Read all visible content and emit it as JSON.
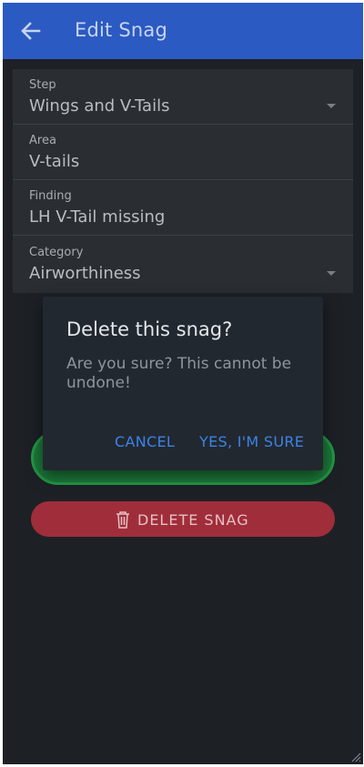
{
  "appbar": {
    "title": "Edit Snag",
    "back_icon": "arrow-left-icon"
  },
  "form": {
    "fields": [
      {
        "label": "Step",
        "value": "Wings and V-Tails",
        "has_dropdown": true
      },
      {
        "label": "Area",
        "value": "V-tails",
        "has_dropdown": false
      },
      {
        "label": "Finding",
        "value": "LH V-Tail missing",
        "has_dropdown": false
      },
      {
        "label": "Category",
        "value": "Airworthiness",
        "has_dropdown": true
      }
    ]
  },
  "delete_button": {
    "label": "DELETE SNAG",
    "icon": "trash-icon"
  },
  "dialog": {
    "title": "Delete this snag?",
    "body": "Are you sure? This cannot be undone!",
    "cancel_label": "CANCEL",
    "confirm_label": "YES, I'M SURE"
  },
  "colors": {
    "appbar": "#2b5ac2",
    "background": "#1d2126",
    "save_button": "#1c7a3a",
    "delete_button": "#a02d3a",
    "dialog_action": "#3b83e8"
  }
}
